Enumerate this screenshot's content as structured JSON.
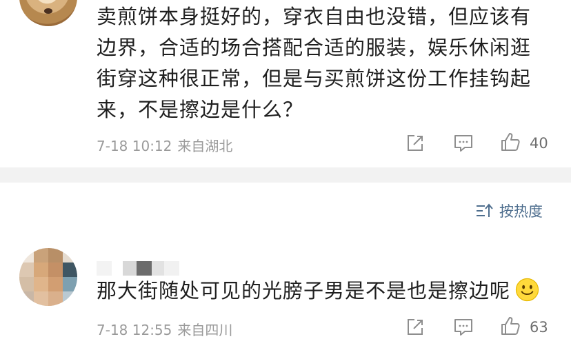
{
  "comments": [
    {
      "text": "卖煎饼本身挺好的，穿衣自由也没错，但应该有边界，合适的场合搭配合适的服装，娱乐休闲逛街穿这种很正常，但是与买煎饼这份工作挂钩起来，不是擦边是什么？",
      "time": "7-18 10:12",
      "location": "来自湖北",
      "likes": "40"
    },
    {
      "text": "那大街随处可见的光膀子男是不是也是擦边呢",
      "time": "7-18 12:55",
      "location": "来自四川",
      "likes": "63"
    }
  ],
  "sort": {
    "label": "按热度"
  },
  "icons": {
    "share": "share-icon",
    "comment": "comment-icon",
    "like": "thumbs-up-icon",
    "sort": "sort-icon",
    "emoji": "smile-emoji-icon"
  },
  "colors": {
    "text": "#1f1f1f",
    "meta": "#9a9a9a",
    "icon": "#8e8e8e",
    "link": "#4e6e8e",
    "separator": "#f2f2f2"
  }
}
